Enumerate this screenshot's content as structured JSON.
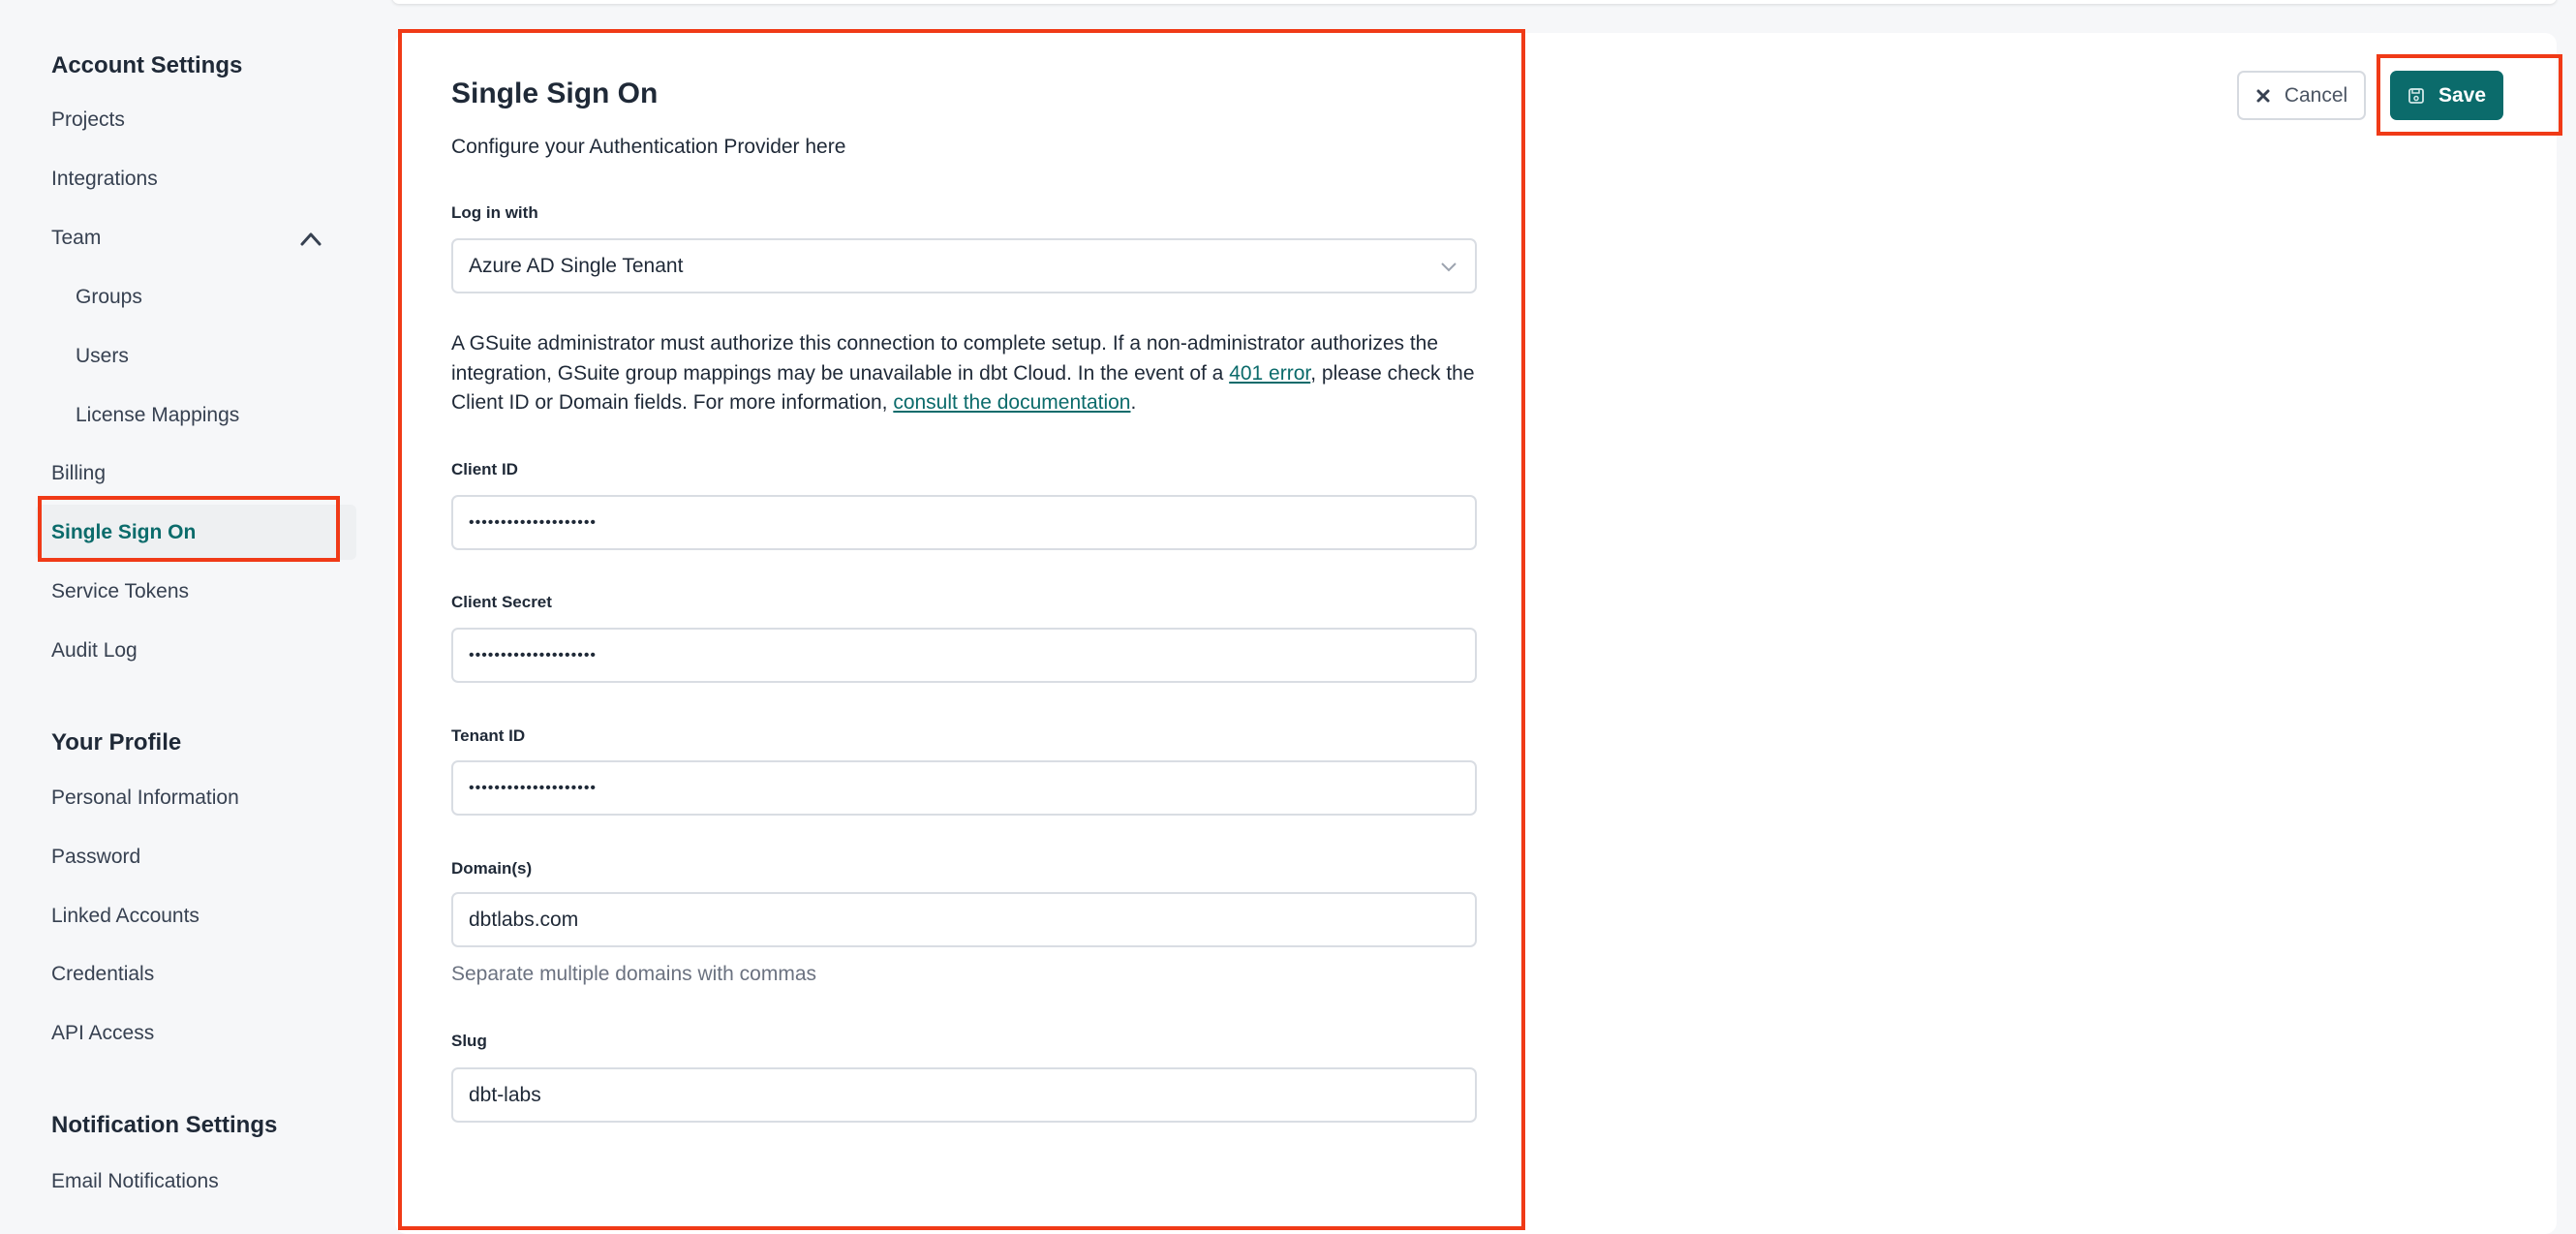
{
  "sidebar": {
    "account_settings": "Account Settings",
    "items": {
      "projects": "Projects",
      "integrations": "Integrations",
      "team": "Team",
      "groups": "Groups",
      "users": "Users",
      "license_mappings": "License Mappings",
      "billing": "Billing",
      "single_sign_on": "Single Sign On",
      "service_tokens": "Service Tokens",
      "audit_log": "Audit Log"
    },
    "your_profile": "Your Profile",
    "profile_items": {
      "personal_information": "Personal Information",
      "password": "Password",
      "linked_accounts": "Linked Accounts",
      "credentials": "Credentials",
      "api_access": "API Access"
    },
    "notification_settings": "Notification Settings",
    "notification_items": {
      "email_notifications": "Email Notifications"
    }
  },
  "main": {
    "title": "Single Sign On",
    "subtitle": "Configure your Authentication Provider here",
    "login_with_label": "Log in with",
    "login_with_value": "Azure AD Single Tenant",
    "notice": {
      "part1": "A GSuite administrator must authorize this connection to complete setup. If a non-administrator authorizes the integration, GSuite group mappings may be unavailable in dbt Cloud. In the event of a ",
      "link1": "401 error",
      "part2": ", please check the Client ID or Domain fields. For more information, ",
      "link2": "consult the documentation",
      "part3": "."
    },
    "client_id_label": "Client ID",
    "client_id_value": "••••••••••••••••••••",
    "client_secret_label": "Client Secret",
    "client_secret_value": "••••••••••••••••••••",
    "tenant_id_label": "Tenant ID",
    "tenant_id_value": "••••••••••••••••••••",
    "domains_label": "Domain(s)",
    "domains_value": "dbtlabs.com",
    "domains_help": "Separate multiple domains with commas",
    "slug_label": "Slug",
    "slug_value": "dbt-labs"
  },
  "actions": {
    "cancel": "Cancel",
    "save": "Save"
  },
  "colors": {
    "accent": "#0b6b6b",
    "highlight_box": "#f03a17"
  },
  "icons": {
    "cancel": "x-icon",
    "save": "floppy-disk-icon",
    "team": "chevron-up-icon",
    "select": "chevron-down-icon"
  }
}
